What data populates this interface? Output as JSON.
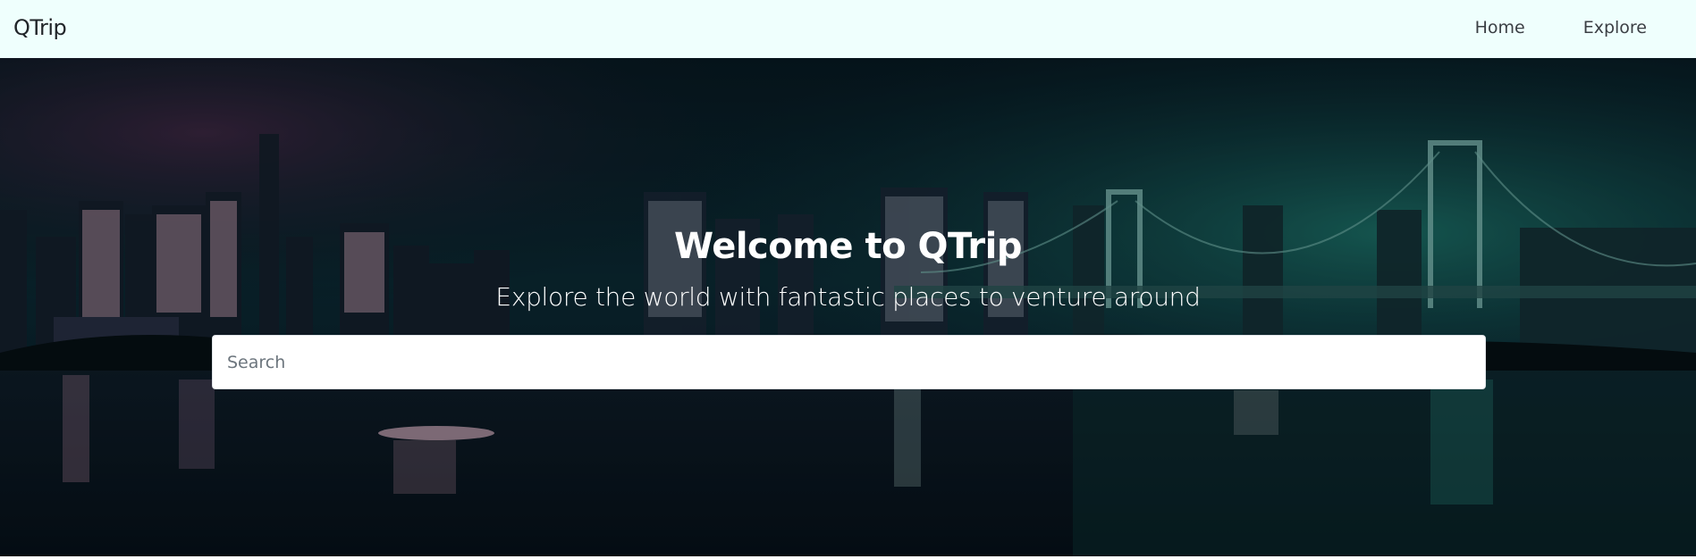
{
  "navbar": {
    "brand": "QTrip",
    "links": [
      {
        "label": "Home"
      },
      {
        "label": "Explore"
      }
    ],
    "background": "#effffd"
  },
  "hero": {
    "title": "Welcome to QTrip",
    "subtitle": "Explore the world with fantastic places to venture around",
    "search": {
      "placeholder": "Search",
      "value": ""
    },
    "background_scene": "night-city-skyline-with-bridge"
  }
}
